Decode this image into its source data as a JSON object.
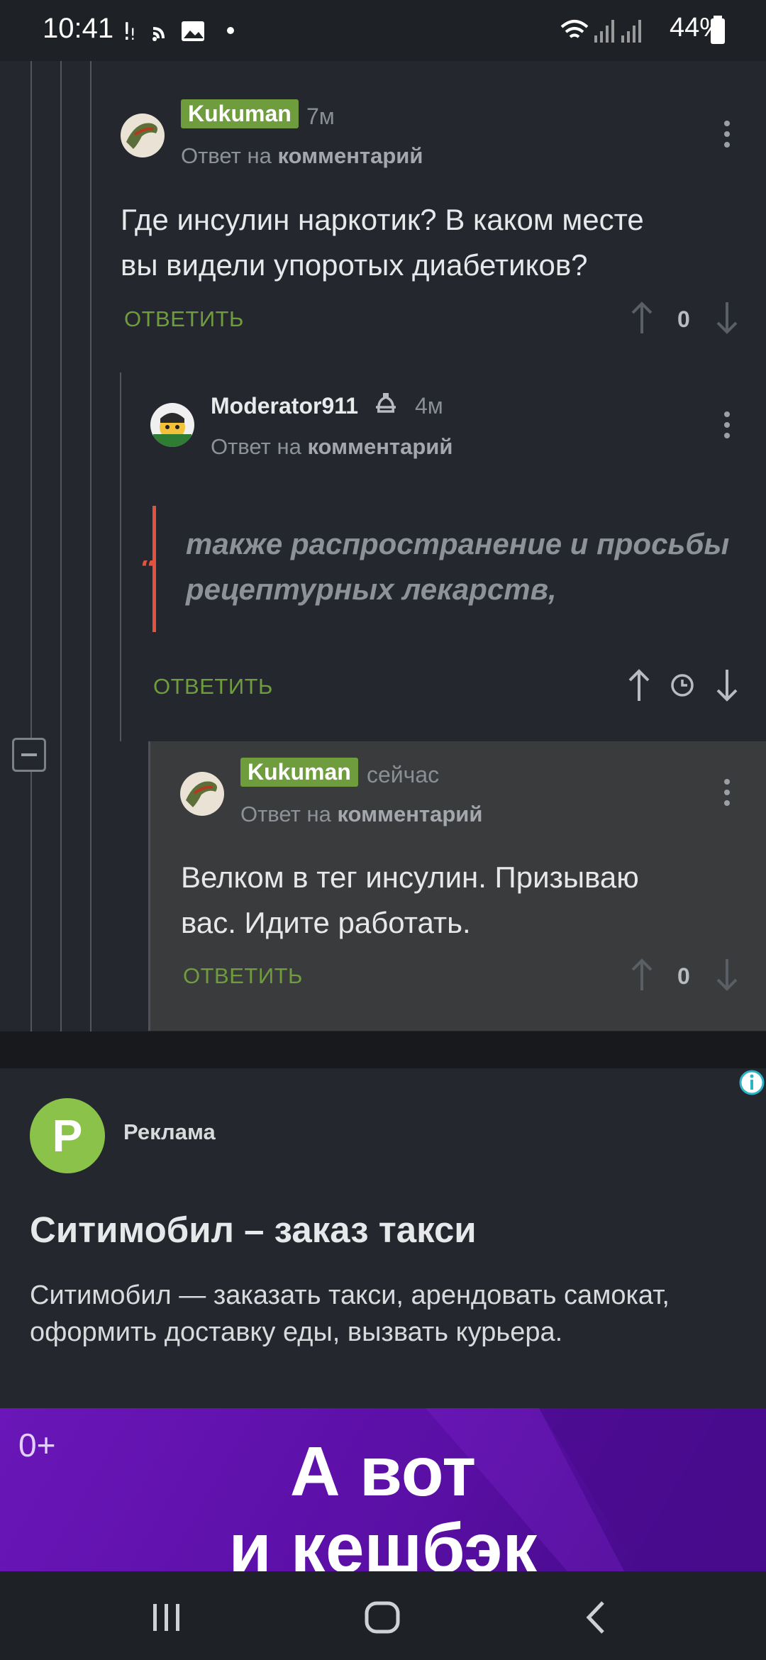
{
  "status": {
    "time": "10:41",
    "battery": "44%"
  },
  "comments": [
    {
      "user": "Kukuman",
      "ago": "7м",
      "reply_prefix": "Ответ на",
      "reply_target": "комментарий",
      "text": [
        "Где инсулин наркотик? В каком месте",
        "вы видели упоротых диабетиков?"
      ],
      "reply_label": "ОТВЕТИТЬ",
      "score": "0"
    },
    {
      "user": "Moderator911",
      "ago": "4м",
      "reply_prefix": "Ответ на",
      "reply_target": "комментарий",
      "quote": [
        "также распространение и просьбы",
        "рецептурных лекарств,"
      ],
      "reply_label": "ОТВЕТИТЬ"
    },
    {
      "user": "Kukuman",
      "ago": "сейчас",
      "reply_prefix": "Ответ на",
      "reply_target": "комментарий",
      "text": [
        "Велком в тег инсулин. Призываю",
        "вас. Идите работать."
      ],
      "reply_label": "ОТВЕТИТЬ",
      "score": "0"
    }
  ],
  "ad": {
    "logo_letter": "P",
    "label": "Реклама",
    "title": "Ситимобил – заказ такси",
    "description": "Ситимобил — заказать такси, арендовать самокат, оформить доставку еды, вызвать курьера.",
    "banner_age": "0+",
    "banner_line1": "А вот",
    "banner_line2": "и кешбэк"
  },
  "colors": {
    "accent": "#6f9d3d",
    "quote": "#e1533e",
    "ad_banner": "#5a0fa5"
  }
}
